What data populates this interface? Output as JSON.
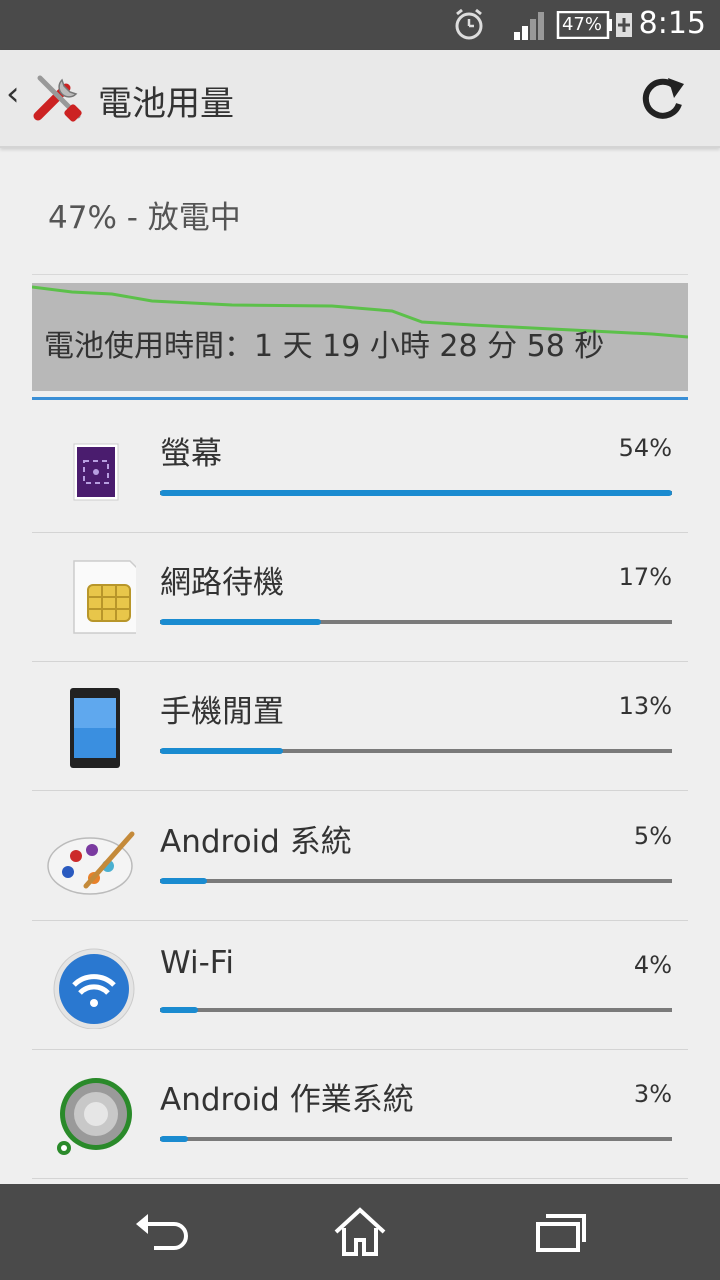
{
  "status_bar": {
    "battery_percent": "47%",
    "time": "8:15"
  },
  "action_bar": {
    "back_icon": "back-caret-icon",
    "app_icon": "settings-tools-icon",
    "title": "電池用量",
    "refresh_icon": "refresh-icon"
  },
  "battery_status": "47% - 放電中",
  "graph": {
    "usage_time": "電池使用時間：1 天 19 小時 28 分 58 秒",
    "line_color": "#5cc04a"
  },
  "items": [
    {
      "name": "螢幕",
      "percent_text": "54%",
      "value": 0.54,
      "icon": "screen-icon"
    },
    {
      "name": "網路待機",
      "percent_text": "17%",
      "value": 0.17,
      "icon": "sim-card-icon"
    },
    {
      "name": "手機閒置",
      "percent_text": "13%",
      "value": 0.13,
      "icon": "phone-idle-icon"
    },
    {
      "name": "Android 系統",
      "percent_text": "5%",
      "value": 0.05,
      "icon": "palette-icon"
    },
    {
      "name": "Wi-Fi",
      "percent_text": "4%",
      "value": 0.04,
      "icon": "wifi-icon"
    },
    {
      "name": "Android 作業系統",
      "percent_text": "3%",
      "value": 0.03,
      "icon": "android-os-icon"
    }
  ],
  "colors": {
    "accent": "#1a8bd0",
    "bar_track": "#7a7a7a",
    "graph_bg": "#b8b8b8"
  },
  "nav_bar": {
    "back_icon": "nav-back-icon",
    "home_icon": "nav-home-icon",
    "recents_icon": "nav-recents-icon"
  }
}
